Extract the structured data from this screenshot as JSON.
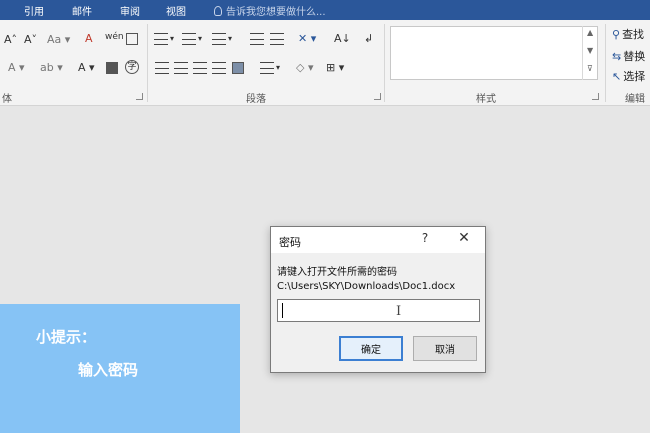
{
  "ribbon_tabs": [
    "引用",
    "邮件",
    "审阅",
    "视图"
  ],
  "tell_me": "告诉我您想要做什么...",
  "font_group": {
    "label": "体",
    "row1": [
      "A˄",
      "A˅",
      "Aa ▾",
      "A",
      "A"
    ],
    "row2": [
      "A",
      "▾",
      "A",
      "A"
    ]
  },
  "paragraph_group": {
    "label": "段落"
  },
  "styles_group": {
    "label": "样式"
  },
  "editing_group": {
    "label": "编辑",
    "find": "查找",
    "replace": "替换",
    "select": "选择"
  },
  "hint": {
    "line1": "小提示：",
    "line2": "输入密码"
  },
  "dialog": {
    "title": "密码",
    "help": "?",
    "close": "✕",
    "prompt": "请键入打开文件所需的密码",
    "path": "C:\\Users\\SKY\\Downloads\\Doc1.docx",
    "input_value": "",
    "ok": "确定",
    "cancel": "取消"
  },
  "colors": {
    "tabbar": "#2b579a",
    "ribbon": "#f3f3f3",
    "canvas": "#e6e6e6",
    "hint_bg": "#86c3f5",
    "ok_border": "#3c7fd2"
  }
}
